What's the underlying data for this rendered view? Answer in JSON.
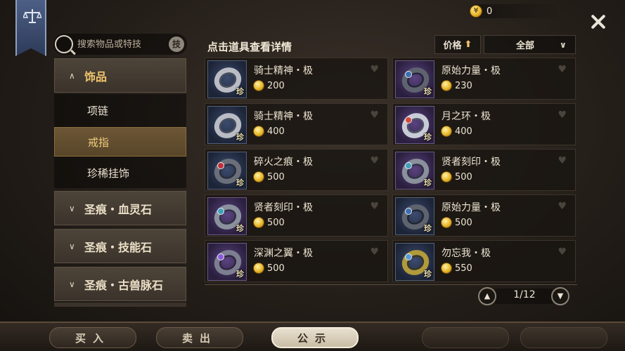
{
  "currency": {
    "amount": "0",
    "coin_glyph": "¥"
  },
  "search": {
    "placeholder": "搜索物品或特技",
    "skill_button": "技"
  },
  "sidebar": {
    "open_category": "饰品",
    "sub_items": [
      "项链",
      "戒指",
      "珍稀挂饰"
    ],
    "active_sub": "戒指",
    "categories": [
      "圣痕・血灵石",
      "圣痕・技能石",
      "圣痕・古兽脉石"
    ]
  },
  "list": {
    "title": "点击道具查看详情",
    "sort_label": "价格",
    "sort_arrow": "⬆",
    "filter_value": "全部",
    "rare_badge": "珍",
    "items": [
      {
        "name": "骑士精神・极",
        "price": "200",
        "thumb": "blue",
        "ring": "steel"
      },
      {
        "name": "原始力量・极",
        "price": "230",
        "thumb": "purple",
        "ring": "dark"
      },
      {
        "name": "骑士精神・极",
        "price": "400",
        "thumb": "blue",
        "ring": "steel"
      },
      {
        "name": "月之环・极",
        "price": "400",
        "thumb": "purple",
        "ring": "moon"
      },
      {
        "name": "碎火之痕・极",
        "price": "500",
        "thumb": "blue",
        "ring": "fire"
      },
      {
        "name": "贤者刻印・极",
        "price": "500",
        "thumb": "purple",
        "ring": "sage"
      },
      {
        "name": "贤者刻印・极",
        "price": "500",
        "thumb": "purple",
        "ring": "sage"
      },
      {
        "name": "原始力量・极",
        "price": "500",
        "thumb": "blue",
        "ring": "dark"
      },
      {
        "name": "深渊之翼・极",
        "price": "500",
        "thumb": "purple",
        "ring": "abyss"
      },
      {
        "name": "勿忘我・极",
        "price": "550",
        "thumb": "blue",
        "ring": "gold"
      }
    ]
  },
  "pager": {
    "text": "1/12",
    "prev_glyph": "▲",
    "next_glyph": "▼"
  },
  "tabs": [
    "买入",
    "卖出",
    "公示"
  ],
  "active_tab": "公示",
  "colors": {
    "accent_gold": "#f0c46c",
    "active_sub_bg": "#6c5637",
    "panel_bg": "#241e19"
  }
}
